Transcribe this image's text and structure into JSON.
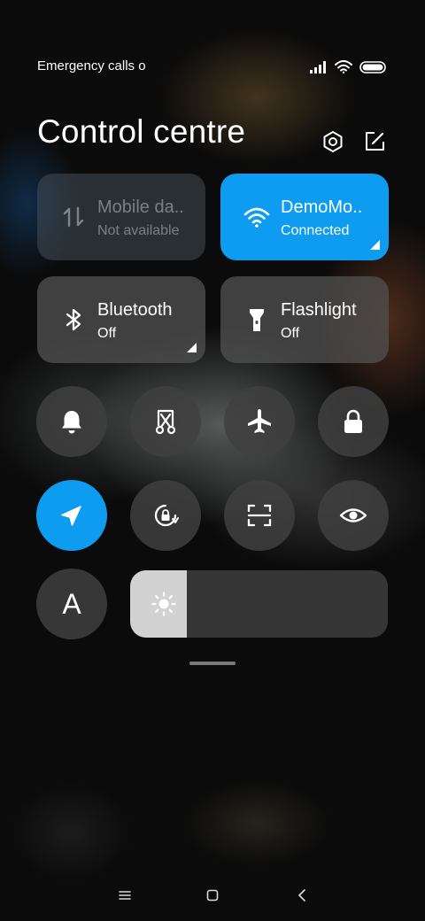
{
  "status_bar": {
    "carrier": "Emergency calls o",
    "icons": [
      "signal-icon",
      "wifi-icon",
      "battery-icon"
    ]
  },
  "header": {
    "title": "Control centre",
    "icons": [
      "settings-icon",
      "edit-icon"
    ]
  },
  "tiles": {
    "mobile_data": {
      "label": "Mobile da..",
      "sub": "Not available",
      "icon": "mobile-data-icon",
      "state": "disabled"
    },
    "wifi": {
      "label": "DemoMo..",
      "sub": "Connected",
      "icon": "wifi-icon",
      "state": "on"
    },
    "bluetooth": {
      "label": "Bluetooth",
      "sub": "Off",
      "icon": "bluetooth-icon",
      "state": "off"
    },
    "flashlight": {
      "label": "Flashlight",
      "sub": "Off",
      "icon": "flashlight-icon",
      "state": "off"
    }
  },
  "toggles_row1": [
    "bell-icon",
    "screenshot-scissors-icon",
    "airplane-icon",
    "lock-icon"
  ],
  "toggles_row2": [
    "location-icon",
    "rotation-lock-icon",
    "scan-icon",
    "eye-icon"
  ],
  "auto_brightness": {
    "label": "A"
  },
  "brightness": {
    "level": 0.22,
    "icon": "sun-icon"
  },
  "nav_bar": [
    "menu-icon",
    "home-icon",
    "back-icon"
  ],
  "colors": {
    "accent": "#0d9cf0",
    "tile": "#505050",
    "slider_fill": "#d2d2d2"
  }
}
